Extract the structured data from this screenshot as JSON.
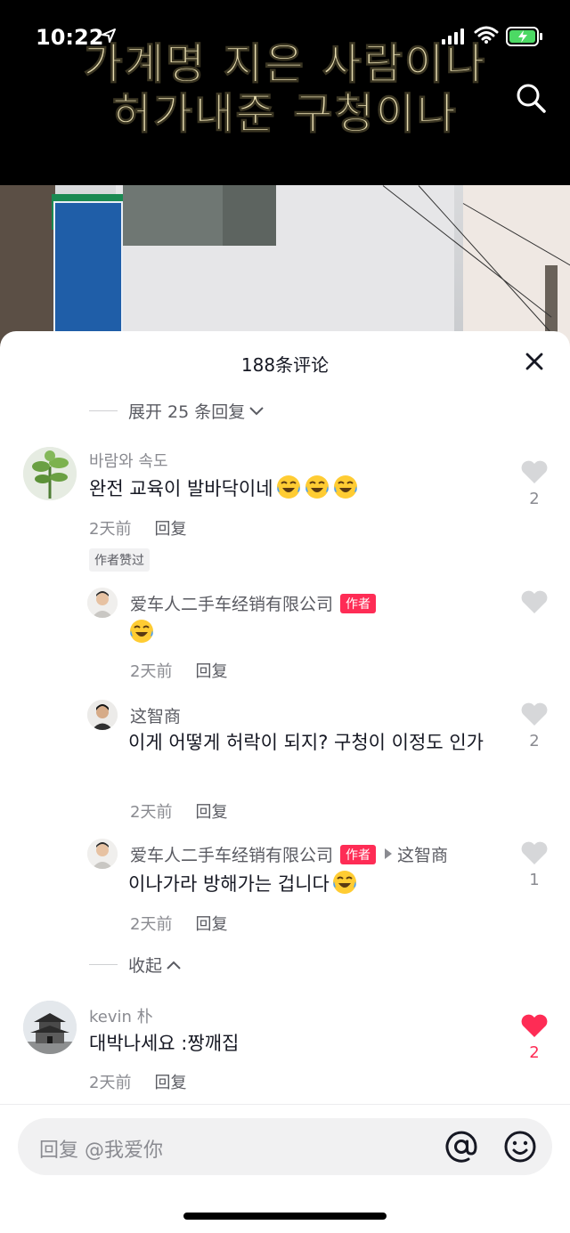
{
  "status": {
    "time": "10:22"
  },
  "video": {
    "caption_line1": "가계명 지은 사람이나",
    "caption_line2": "허가내준 구청이나"
  },
  "sheet": {
    "title": "188条评论",
    "expand_label": "展开 25 条回复",
    "collapse_label": "收起",
    "comments": [
      {
        "user": "바람와 속도",
        "text": "완전 교육이 발바닥이네",
        "time": "2天前",
        "reply": "回复",
        "likes": "2",
        "tag": "作者赞过"
      },
      {
        "user": "爱车人二手车经销有限公司",
        "badge": "作者",
        "text": "",
        "time": "2天前",
        "reply": "回复",
        "likes": ""
      },
      {
        "user": "这智商",
        "text": "이게 어떻게 허락이 되지? 구청이 이정도 인가",
        "time": "2天前",
        "reply": "回复",
        "likes": "2"
      },
      {
        "user": "爱车人二手车经销有限公司",
        "badge": "作者",
        "reply_to": "这智商",
        "text": "이나가라 방해가는 겁니다",
        "time": "2天前",
        "reply": "回复",
        "likes": "1"
      },
      {
        "user": "kevin 朴",
        "text": "대박나세요 :짱깨집",
        "time": "2天前",
        "reply": "回复",
        "likes": "2",
        "liked": true
      }
    ]
  },
  "input": {
    "placeholder": "回复 @我爱你"
  },
  "colors": {
    "accent": "#fe2c55",
    "caption": "#e7dcb0"
  }
}
